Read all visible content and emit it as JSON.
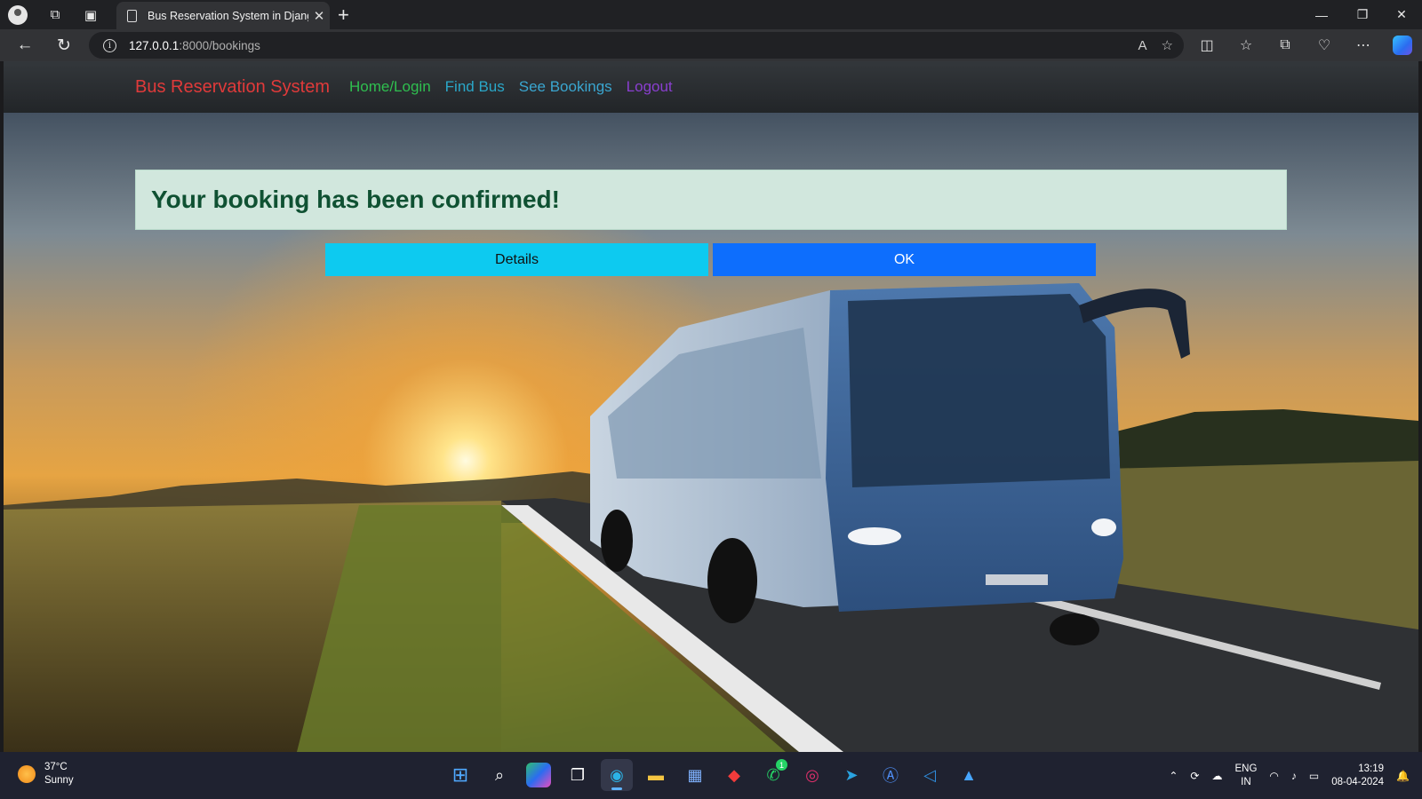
{
  "browser": {
    "tab_title": "Bus Reservation System in Djang",
    "url_host": "127.0.0.1",
    "url_path": ":8000/bookings",
    "read_aloud_label": "A"
  },
  "navbar": {
    "brand": "Bus Reservation System",
    "links": [
      {
        "label": "Home/Login"
      },
      {
        "label": "Find Bus"
      },
      {
        "label": "See Bookings"
      },
      {
        "label": "Logout"
      }
    ]
  },
  "main": {
    "alert_text": "Your booking has been confirmed!",
    "details_button": "Details",
    "ok_button": "OK"
  },
  "taskbar": {
    "temperature": "37°C",
    "condition": "Sunny",
    "whatsapp_badge": "1",
    "lang_top": "ENG",
    "lang_bottom": "IN",
    "time": "13:19",
    "date": "08-04-2024"
  },
  "colors": {
    "brand": "#e03a3a",
    "alert_bg": "#d1e7dd",
    "alert_text": "#0f5132",
    "details_btn": "#0dcaf0",
    "ok_btn": "#0d6efd"
  }
}
